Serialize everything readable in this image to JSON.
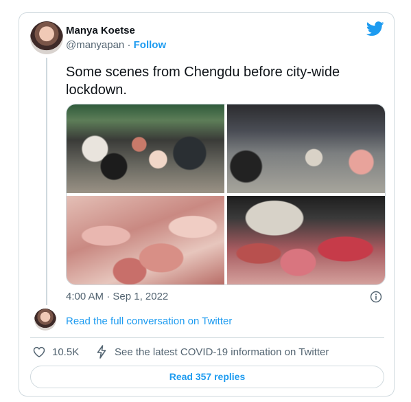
{
  "author": {
    "name": "Manya Koetse",
    "handle": "@manyapan",
    "separator": "·",
    "follow_label": "Follow"
  },
  "tweet": {
    "text": "Some scenes from Chengdu before city-wide lockdown.",
    "timestamp": "4:00 AM · Sep 1, 2022"
  },
  "conversation": {
    "link_label": "Read the full conversation on Twitter"
  },
  "actions": {
    "likes_count": "10.5K",
    "covid_label": "See the latest COVID-19 information on Twitter",
    "replies_label": "Read 357 replies"
  },
  "icons": {
    "brand": "twitter-bird-icon",
    "info": "info-icon",
    "like": "heart-icon",
    "covid": "bolt-icon"
  },
  "colors": {
    "accent": "#1d9bf0",
    "muted": "#536471",
    "border": "#cfd9de"
  }
}
